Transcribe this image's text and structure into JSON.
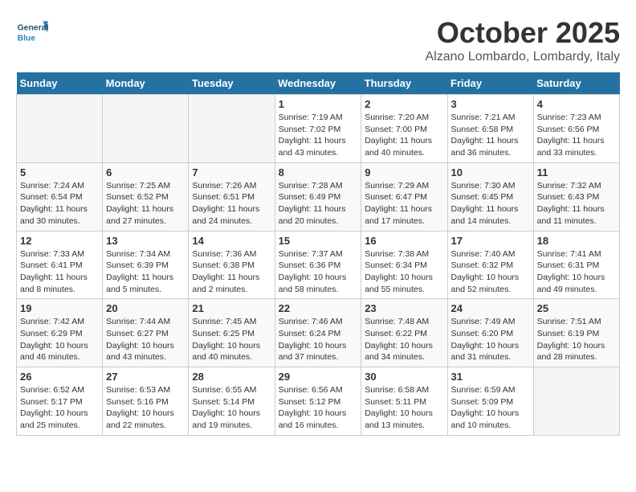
{
  "header": {
    "logo_general": "General",
    "logo_blue": "Blue",
    "month": "October 2025",
    "location": "Alzano Lombardo, Lombardy, Italy"
  },
  "weekdays": [
    "Sunday",
    "Monday",
    "Tuesday",
    "Wednesday",
    "Thursday",
    "Friday",
    "Saturday"
  ],
  "weeks": [
    [
      {
        "day": "",
        "info": ""
      },
      {
        "day": "",
        "info": ""
      },
      {
        "day": "",
        "info": ""
      },
      {
        "day": "1",
        "info": "Sunrise: 7:19 AM\nSunset: 7:02 PM\nDaylight: 11 hours and 43 minutes."
      },
      {
        "day": "2",
        "info": "Sunrise: 7:20 AM\nSunset: 7:00 PM\nDaylight: 11 hours and 40 minutes."
      },
      {
        "day": "3",
        "info": "Sunrise: 7:21 AM\nSunset: 6:58 PM\nDaylight: 11 hours and 36 minutes."
      },
      {
        "day": "4",
        "info": "Sunrise: 7:23 AM\nSunset: 6:56 PM\nDaylight: 11 hours and 33 minutes."
      }
    ],
    [
      {
        "day": "5",
        "info": "Sunrise: 7:24 AM\nSunset: 6:54 PM\nDaylight: 11 hours and 30 minutes."
      },
      {
        "day": "6",
        "info": "Sunrise: 7:25 AM\nSunset: 6:52 PM\nDaylight: 11 hours and 27 minutes."
      },
      {
        "day": "7",
        "info": "Sunrise: 7:26 AM\nSunset: 6:51 PM\nDaylight: 11 hours and 24 minutes."
      },
      {
        "day": "8",
        "info": "Sunrise: 7:28 AM\nSunset: 6:49 PM\nDaylight: 11 hours and 20 minutes."
      },
      {
        "day": "9",
        "info": "Sunrise: 7:29 AM\nSunset: 6:47 PM\nDaylight: 11 hours and 17 minutes."
      },
      {
        "day": "10",
        "info": "Sunrise: 7:30 AM\nSunset: 6:45 PM\nDaylight: 11 hours and 14 minutes."
      },
      {
        "day": "11",
        "info": "Sunrise: 7:32 AM\nSunset: 6:43 PM\nDaylight: 11 hours and 11 minutes."
      }
    ],
    [
      {
        "day": "12",
        "info": "Sunrise: 7:33 AM\nSunset: 6:41 PM\nDaylight: 11 hours and 8 minutes."
      },
      {
        "day": "13",
        "info": "Sunrise: 7:34 AM\nSunset: 6:39 PM\nDaylight: 11 hours and 5 minutes."
      },
      {
        "day": "14",
        "info": "Sunrise: 7:36 AM\nSunset: 6:38 PM\nDaylight: 11 hours and 2 minutes."
      },
      {
        "day": "15",
        "info": "Sunrise: 7:37 AM\nSunset: 6:36 PM\nDaylight: 10 hours and 58 minutes."
      },
      {
        "day": "16",
        "info": "Sunrise: 7:38 AM\nSunset: 6:34 PM\nDaylight: 10 hours and 55 minutes."
      },
      {
        "day": "17",
        "info": "Sunrise: 7:40 AM\nSunset: 6:32 PM\nDaylight: 10 hours and 52 minutes."
      },
      {
        "day": "18",
        "info": "Sunrise: 7:41 AM\nSunset: 6:31 PM\nDaylight: 10 hours and 49 minutes."
      }
    ],
    [
      {
        "day": "19",
        "info": "Sunrise: 7:42 AM\nSunset: 6:29 PM\nDaylight: 10 hours and 46 minutes."
      },
      {
        "day": "20",
        "info": "Sunrise: 7:44 AM\nSunset: 6:27 PM\nDaylight: 10 hours and 43 minutes."
      },
      {
        "day": "21",
        "info": "Sunrise: 7:45 AM\nSunset: 6:25 PM\nDaylight: 10 hours and 40 minutes."
      },
      {
        "day": "22",
        "info": "Sunrise: 7:46 AM\nSunset: 6:24 PM\nDaylight: 10 hours and 37 minutes."
      },
      {
        "day": "23",
        "info": "Sunrise: 7:48 AM\nSunset: 6:22 PM\nDaylight: 10 hours and 34 minutes."
      },
      {
        "day": "24",
        "info": "Sunrise: 7:49 AM\nSunset: 6:20 PM\nDaylight: 10 hours and 31 minutes."
      },
      {
        "day": "25",
        "info": "Sunrise: 7:51 AM\nSunset: 6:19 PM\nDaylight: 10 hours and 28 minutes."
      }
    ],
    [
      {
        "day": "26",
        "info": "Sunrise: 6:52 AM\nSunset: 5:17 PM\nDaylight: 10 hours and 25 minutes."
      },
      {
        "day": "27",
        "info": "Sunrise: 6:53 AM\nSunset: 5:16 PM\nDaylight: 10 hours and 22 minutes."
      },
      {
        "day": "28",
        "info": "Sunrise: 6:55 AM\nSunset: 5:14 PM\nDaylight: 10 hours and 19 minutes."
      },
      {
        "day": "29",
        "info": "Sunrise: 6:56 AM\nSunset: 5:12 PM\nDaylight: 10 hours and 16 minutes."
      },
      {
        "day": "30",
        "info": "Sunrise: 6:58 AM\nSunset: 5:11 PM\nDaylight: 10 hours and 13 minutes."
      },
      {
        "day": "31",
        "info": "Sunrise: 6:59 AM\nSunset: 5:09 PM\nDaylight: 10 hours and 10 minutes."
      },
      {
        "day": "",
        "info": ""
      }
    ]
  ]
}
